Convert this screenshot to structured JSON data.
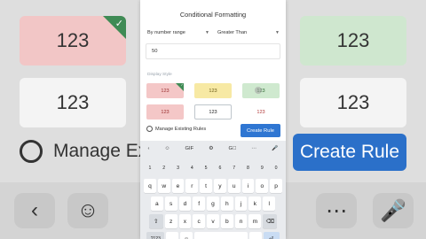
{
  "background": {
    "cards": [
      "123",
      "123",
      "123",
      "123"
    ],
    "manage_label": "Manage Exi",
    "create_label": "Create Rule"
  },
  "dialog": {
    "title": "Conditional Formatting",
    "range_select": "By number range",
    "condition_select": "Greater Than",
    "value_input": "50",
    "display_style_label": "Display Style",
    "swatches": [
      {
        "text": "123",
        "style": "red",
        "selected": true
      },
      {
        "text": "123",
        "style": "yellow",
        "selected": false
      },
      {
        "text": "123",
        "style": "green",
        "selected": false
      },
      {
        "text": "123",
        "style": "red-fill",
        "selected": false
      },
      {
        "text": "123",
        "style": "outlined",
        "selected": false
      },
      {
        "text": "123",
        "style": "red-text",
        "selected": false
      }
    ],
    "manage_label": "Manage Existing Rules",
    "create_label": "Create Rule"
  },
  "keyboard": {
    "toolbar": [
      "‹",
      "☺",
      "GIF",
      "⚙",
      "G⃞",
      "⋯",
      "🎤"
    ],
    "numbers": [
      "1",
      "2",
      "3",
      "4",
      "5",
      "6",
      "7",
      "8",
      "9",
      "0"
    ],
    "row1": [
      "q",
      "w",
      "e",
      "r",
      "t",
      "y",
      "u",
      "i",
      "o",
      "p"
    ],
    "row2": [
      "a",
      "s",
      "d",
      "f",
      "g",
      "h",
      "j",
      "k",
      "l"
    ],
    "row3": [
      "⇧",
      "z",
      "x",
      "c",
      "v",
      "b",
      "n",
      "m",
      "⌫"
    ],
    "row4": [
      "?123",
      ",",
      "☺",
      "",
      ".",
      "⏎"
    ]
  },
  "colors": {
    "accent": "#2f76d2",
    "selected_tag": "#3f8b55"
  }
}
